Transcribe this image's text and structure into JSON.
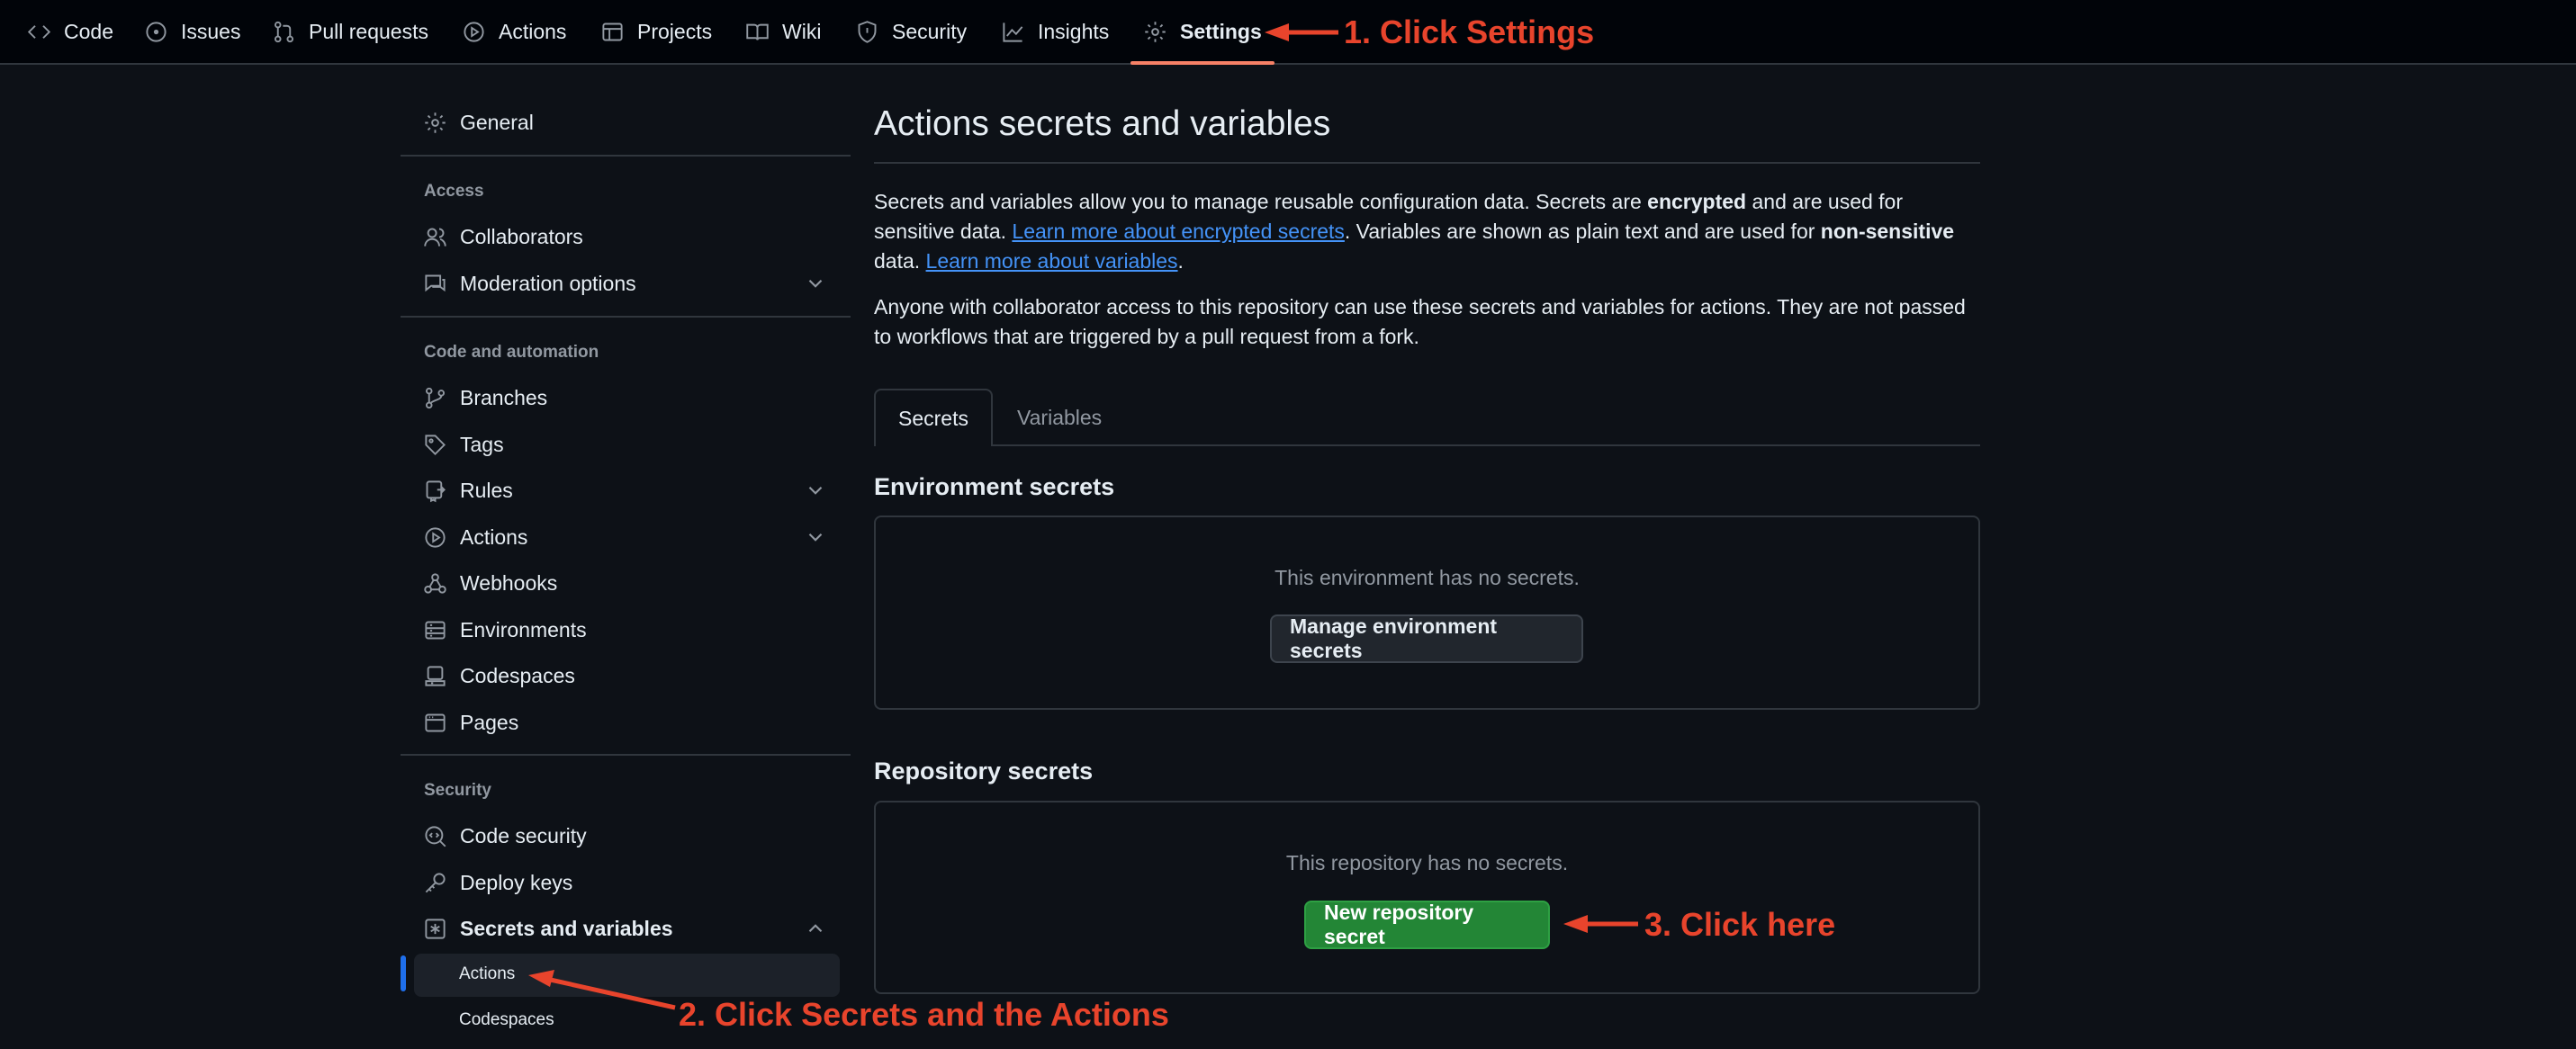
{
  "topnav": {
    "tabs": [
      {
        "label": "Code",
        "icon": "code-icon"
      },
      {
        "label": "Issues",
        "icon": "issue-icon"
      },
      {
        "label": "Pull requests",
        "icon": "pull-request-icon"
      },
      {
        "label": "Actions",
        "icon": "play-icon"
      },
      {
        "label": "Projects",
        "icon": "table-icon"
      },
      {
        "label": "Wiki",
        "icon": "book-icon"
      },
      {
        "label": "Security",
        "icon": "shield-icon"
      },
      {
        "label": "Insights",
        "icon": "graph-icon"
      },
      {
        "label": "Settings",
        "icon": "gear-icon",
        "active": true
      }
    ]
  },
  "annotations": {
    "step1": "1. Click Settings",
    "step2": "2. Click Secrets and the Actions",
    "step3": "3. Click here",
    "color": "#e8442c"
  },
  "sidebar": {
    "general": "General",
    "access_heading": "Access",
    "collaborators": "Collaborators",
    "moderation": "Moderation options",
    "code_heading": "Code and automation",
    "branches": "Branches",
    "tags": "Tags",
    "rules": "Rules",
    "actions": "Actions",
    "webhooks": "Webhooks",
    "environments": "Environments",
    "codespaces": "Codespaces",
    "pages": "Pages",
    "security_heading": "Security",
    "code_security": "Code security",
    "deploy_keys": "Deploy keys",
    "secrets_vars": "Secrets and variables",
    "sub_actions": "Actions",
    "sub_codespaces": "Codespaces"
  },
  "main": {
    "title": "Actions secrets and variables",
    "p1_a": "Secrets and variables allow you to manage reusable configuration data. Secrets are ",
    "p1_b": "encrypted",
    "p1_c": " and are used for sensitive data. ",
    "p1_link1": "Learn more about encrypted secrets",
    "p1_d": ". Variables are shown as plain text and are used for ",
    "p1_e": "non-sensitive",
    "p1_f": " data. ",
    "p1_link2": "Learn more about variables",
    "p1_g": ".",
    "p2": "Anyone with collaborator access to this repository can use these secrets and variables for actions. They are not passed to workflows that are triggered by a pull request from a fork.",
    "tabs": [
      "Secrets",
      "Variables"
    ],
    "env_heading": "Environment secrets",
    "env_empty": "This environment has no secrets.",
    "env_button": "Manage environment secrets",
    "repo_heading": "Repository secrets",
    "repo_empty": "This repository has no secrets.",
    "repo_button": "New repository secret"
  },
  "colors": {
    "accent_underline": "#f78166",
    "link": "#4493f8",
    "primary_button": "#238636",
    "active_indicator": "#1f6feb"
  }
}
